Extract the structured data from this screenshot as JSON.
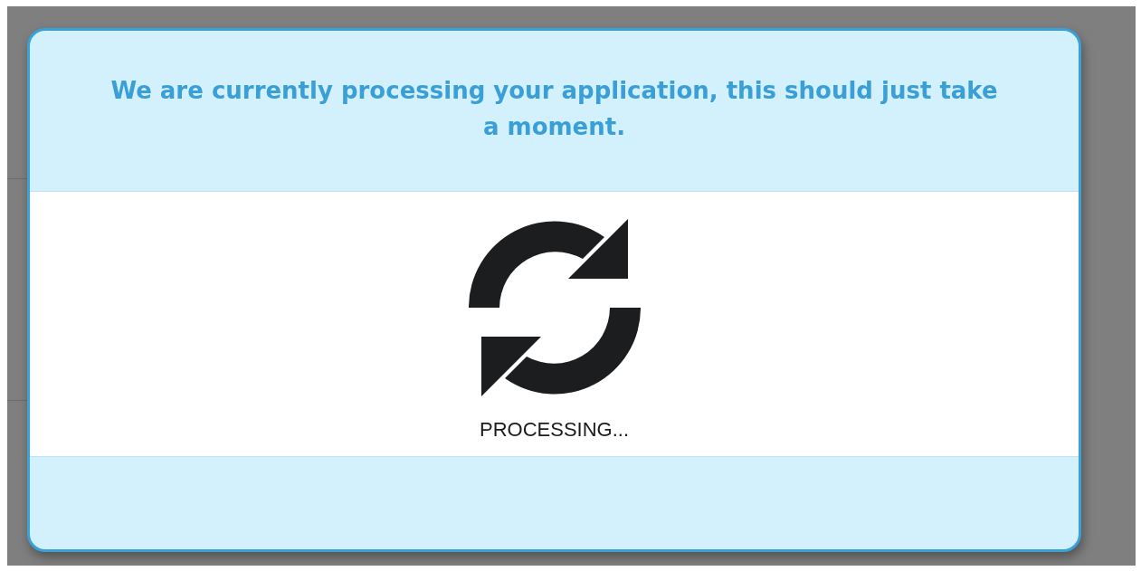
{
  "dialog": {
    "message": "We are currently processing your application, this should just take a moment.",
    "status": "PROCESSING..."
  }
}
